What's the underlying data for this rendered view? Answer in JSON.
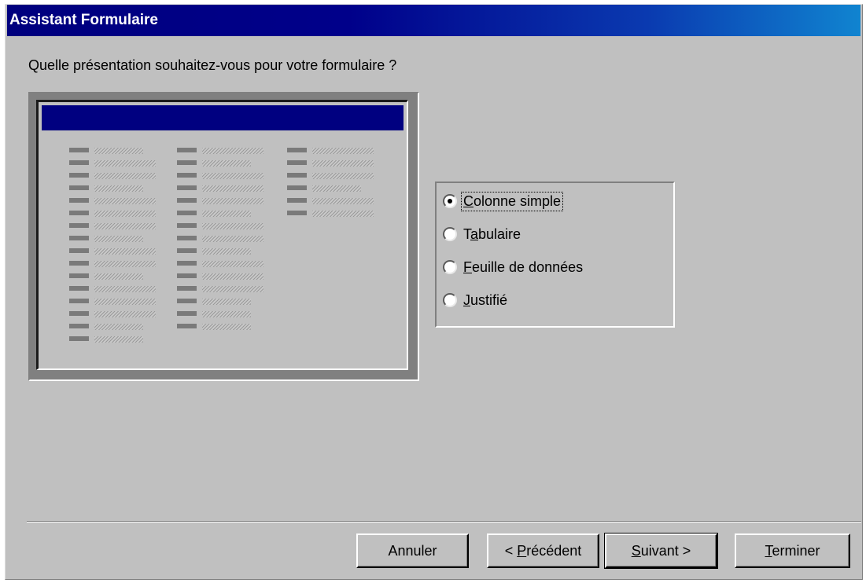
{
  "window": {
    "title": "Assistant Formulaire"
  },
  "prompt": "Quelle présentation souhaitez-vous pour votre formulaire ?",
  "layout_options": [
    {
      "pre": "",
      "key": "C",
      "post": "olonne simple",
      "selected": true
    },
    {
      "pre": "T",
      "key": "a",
      "post": "bulaire",
      "selected": false
    },
    {
      "pre": "",
      "key": "F",
      "post": "euille de données",
      "selected": false
    },
    {
      "pre": "",
      "key": "J",
      "post": "ustifié",
      "selected": false
    }
  ],
  "buttons": {
    "cancel": {
      "pre": "Annuler",
      "key": "",
      "post": ""
    },
    "previous": {
      "pre": "< ",
      "key": "P",
      "post": "récédent"
    },
    "next": {
      "pre": "",
      "key": "S",
      "post": "uivant >"
    },
    "finish": {
      "pre": "",
      "key": "T",
      "post": "erminer"
    }
  },
  "colors": {
    "title_bar": "#000080",
    "dialog_face": "#c0c0c0"
  }
}
